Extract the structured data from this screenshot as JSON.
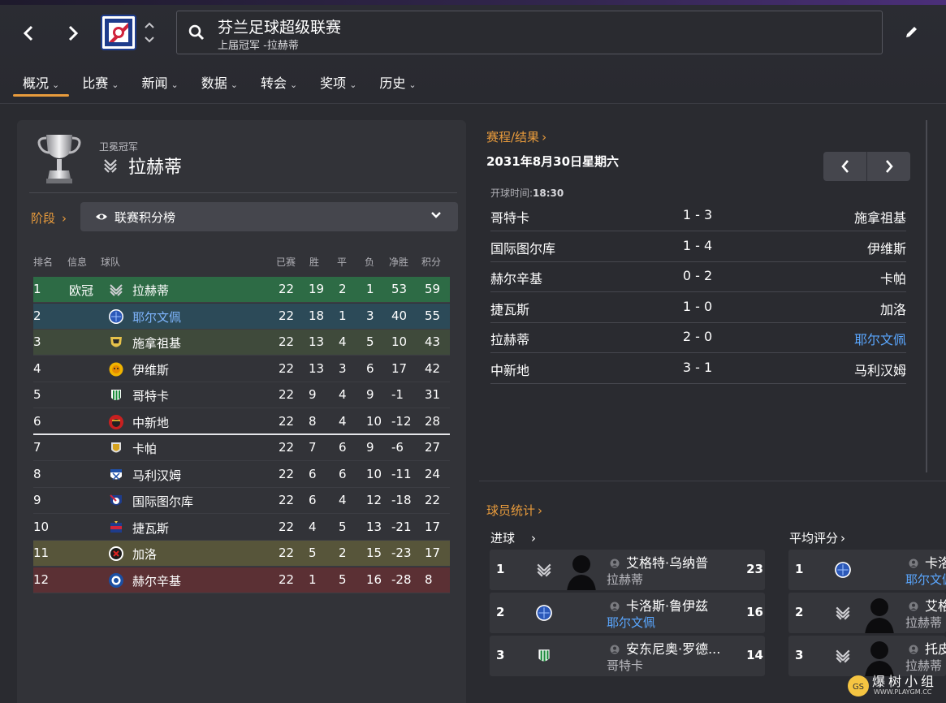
{
  "header": {
    "search_title": "芬兰足球超级联赛",
    "search_subtitle": "上届冠军 -拉赫蒂",
    "back_label": "‹",
    "forward_label": "›"
  },
  "menu": [
    {
      "label": "概况",
      "active": true
    },
    {
      "label": "比赛"
    },
    {
      "label": "新闻"
    },
    {
      "label": "数据"
    },
    {
      "label": "转会"
    },
    {
      "label": "奖项"
    },
    {
      "label": "历史"
    }
  ],
  "holder": {
    "label": "卫冕冠军",
    "name": "拉赫蒂"
  },
  "stage": {
    "link": "阶段",
    "value": "联赛积分榜"
  },
  "table": {
    "headers": [
      "排名",
      "信息",
      "球队",
      "已赛",
      "胜",
      "平",
      "负",
      "净胜",
      "积分"
    ],
    "rows": [
      {
        "pos": "1",
        "info": "欧冠",
        "team": "拉赫蒂",
        "p": "22",
        "w": "19",
        "d": "2",
        "l": "1",
        "gd": "53",
        "pts": "59",
        "bg": "#2d6b45",
        "logo": "lahti"
      },
      {
        "pos": "2",
        "info": "",
        "team": "耶尔文佩",
        "p": "22",
        "w": "18",
        "d": "1",
        "l": "3",
        "gd": "40",
        "pts": "55",
        "bg": "#2c4a58",
        "logo": "jarvenpaa",
        "blue": true
      },
      {
        "pos": "3",
        "info": "",
        "team": "施拿祖基",
        "p": "22",
        "w": "13",
        "d": "4",
        "l": "5",
        "gd": "10",
        "pts": "43",
        "bg": "#3f4a3b",
        "logo": "seinajoki"
      },
      {
        "pos": "4",
        "info": "",
        "team": "伊维斯",
        "p": "22",
        "w": "13",
        "d": "3",
        "l": "6",
        "gd": "17",
        "pts": "42",
        "bg": "",
        "logo": "ilves"
      },
      {
        "pos": "5",
        "info": "",
        "team": "哥特卡",
        "p": "22",
        "w": "9",
        "d": "4",
        "l": "9",
        "gd": "-1",
        "pts": "31",
        "bg": "",
        "logo": "kotka"
      },
      {
        "pos": "6",
        "info": "",
        "team": "中新地",
        "p": "22",
        "w": "8",
        "d": "4",
        "l": "10",
        "gd": "-12",
        "pts": "28",
        "bg": "",
        "logo": "sjk"
      },
      {
        "pos": "7",
        "info": "",
        "team": "卡帕",
        "p": "22",
        "w": "7",
        "d": "6",
        "l": "9",
        "gd": "-6",
        "pts": "27",
        "bg": "",
        "logo": "kapa"
      },
      {
        "pos": "8",
        "info": "",
        "team": "马利汉姆",
        "p": "22",
        "w": "6",
        "d": "6",
        "l": "10",
        "gd": "-11",
        "pts": "24",
        "bg": "",
        "logo": "mariehamn"
      },
      {
        "pos": "9",
        "info": "",
        "team": "国际图尔库",
        "p": "22",
        "w": "6",
        "d": "4",
        "l": "12",
        "gd": "-18",
        "pts": "22",
        "bg": "",
        "logo": "inter"
      },
      {
        "pos": "10",
        "info": "",
        "team": "捷瓦斯",
        "p": "22",
        "w": "4",
        "d": "5",
        "l": "13",
        "gd": "-21",
        "pts": "17",
        "bg": "",
        "logo": "jaro"
      },
      {
        "pos": "11",
        "info": "",
        "team": "加洛",
        "p": "22",
        "w": "5",
        "d": "2",
        "l": "15",
        "gd": "-23",
        "pts": "17",
        "bg": "#57553a",
        "logo": "gaile"
      },
      {
        "pos": "12",
        "info": "",
        "team": "赫尔辛基",
        "p": "22",
        "w": "1",
        "d": "5",
        "l": "16",
        "gd": "-28",
        "pts": "8",
        "bg": "#5b3034",
        "logo": "hjk"
      }
    ]
  },
  "fixtures": {
    "link": "赛程/结果",
    "date": "2031年8月30日星期六",
    "kickoff_label": "开球时间:",
    "kickoff_time": "18:30",
    "matches": [
      {
        "home": "哥特卡",
        "score": "1 - 3",
        "away": "施拿祖基"
      },
      {
        "home": "国际图尔库",
        "score": "1 - 4",
        "away": "伊维斯"
      },
      {
        "home": "赫尔辛基",
        "score": "0 - 2",
        "away": "卡帕"
      },
      {
        "home": "捷瓦斯",
        "score": "1 - 0",
        "away": "加洛"
      },
      {
        "home": "拉赫蒂",
        "score": "2 - 0",
        "away": "耶尔文佩",
        "away_blue": true
      },
      {
        "home": "中新地",
        "score": "3 - 1",
        "away": "马利汉姆"
      }
    ]
  },
  "player_stats": {
    "link": "球员统计",
    "goals": {
      "title": "进球",
      "rows": [
        {
          "rank": "1",
          "name": "艾格特·乌纳普",
          "club": "拉赫蒂",
          "value": "23",
          "logo": "lahti",
          "photo": true
        },
        {
          "rank": "2",
          "name": "卡洛斯·鲁伊兹",
          "club": "耶尔文佩",
          "value": "16",
          "logo": "jarvenpaa",
          "club_blue": true
        },
        {
          "rank": "3",
          "name": "安东尼奥·罗德...",
          "club": "哥特卡",
          "value": "14",
          "logo": "kotka"
        }
      ]
    },
    "rating": {
      "title": "平均评分",
      "rows": [
        {
          "rank": "1",
          "name": "卡洛",
          "club": "耶尔文佩",
          "logo": "jarvenpaa",
          "club_blue": true
        },
        {
          "rank": "2",
          "name": "艾格",
          "club": "拉赫蒂",
          "logo": "lahti",
          "photo": true
        },
        {
          "rank": "3",
          "name": "托皮",
          "club": "拉赫蒂",
          "logo": "lahti",
          "photo": true
        }
      ]
    }
  },
  "watermark": {
    "text": "爆树小组",
    "url": "WWW.PLAYGM.CC"
  },
  "colors": {
    "accent": "#e89b3c",
    "link_blue": "#5aa7ff",
    "panel": "#323338"
  }
}
